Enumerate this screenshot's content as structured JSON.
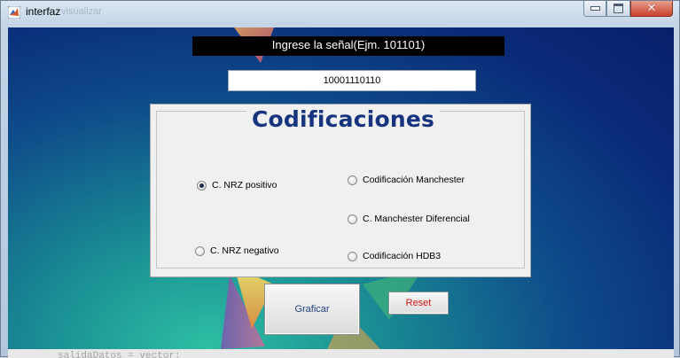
{
  "window": {
    "title": "interfaz",
    "ghost_tab": "visualizar",
    "controls": {
      "minimize": "minimize-icon",
      "maximize": "maximize-icon",
      "close": "close-icon"
    }
  },
  "prompt": {
    "label": "Ingrese la señal(Ejm. 101101)"
  },
  "signal_input": {
    "value": "10001110110"
  },
  "panel": {
    "title": "Codificaciones",
    "options": [
      {
        "label": "C. NRZ positivo",
        "checked": true
      },
      {
        "label": "C. NRZ negativo",
        "checked": false
      },
      {
        "label": "Codificación Manchester",
        "checked": false
      },
      {
        "label": "C. Manchester Diferencial",
        "checked": false
      },
      {
        "label": "Codificación HDB3",
        "checked": false
      }
    ]
  },
  "buttons": {
    "graficar": "Graficar",
    "reset": "Reset"
  },
  "background_snippet": "salidaDatos = vector;",
  "colors": {
    "panel_title": "#17347e",
    "graficar_text": "#1f3f86",
    "reset_text": "#d01515",
    "prompt_bg": "#000000"
  }
}
